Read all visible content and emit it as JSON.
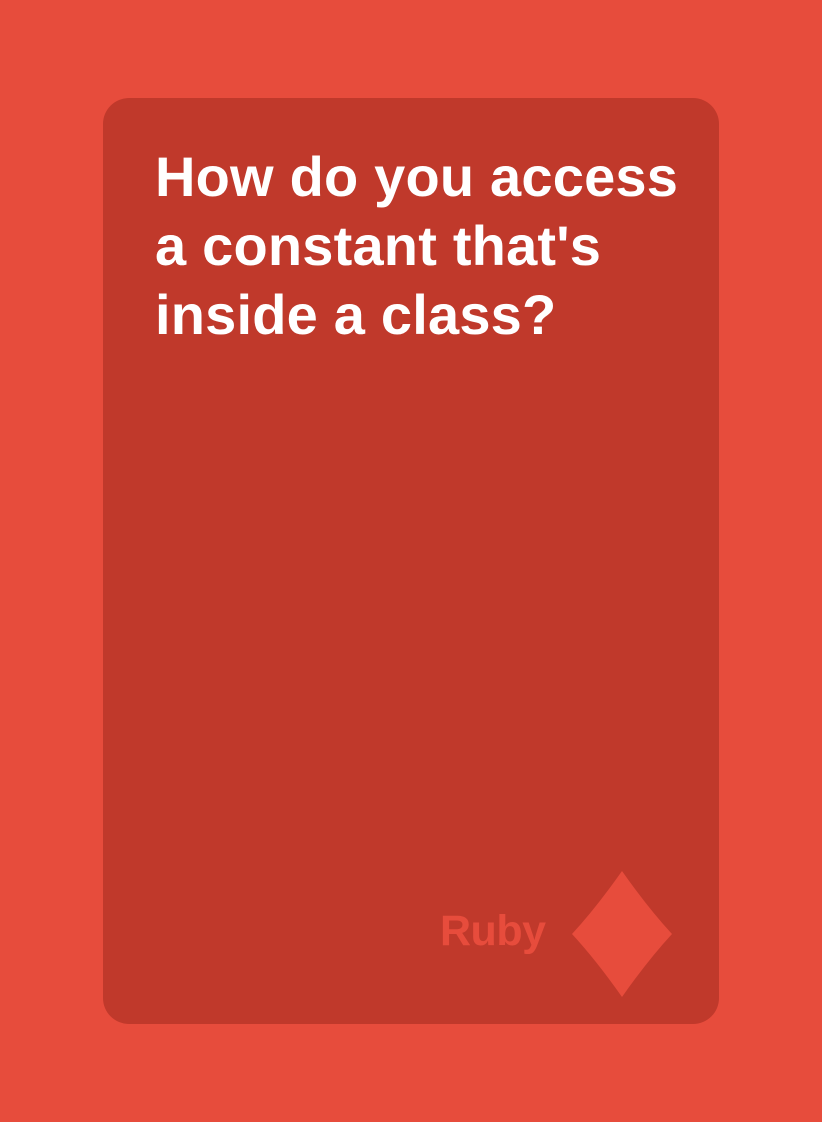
{
  "card": {
    "question": "How do you access a constant that's inside a class?",
    "deck_label": "Ruby",
    "suit_icon": "diamond-icon",
    "colors": {
      "background": "#e74c3c",
      "card": "#c0392b",
      "question_text": "#ffffff",
      "accent": "#e74c3c"
    }
  }
}
